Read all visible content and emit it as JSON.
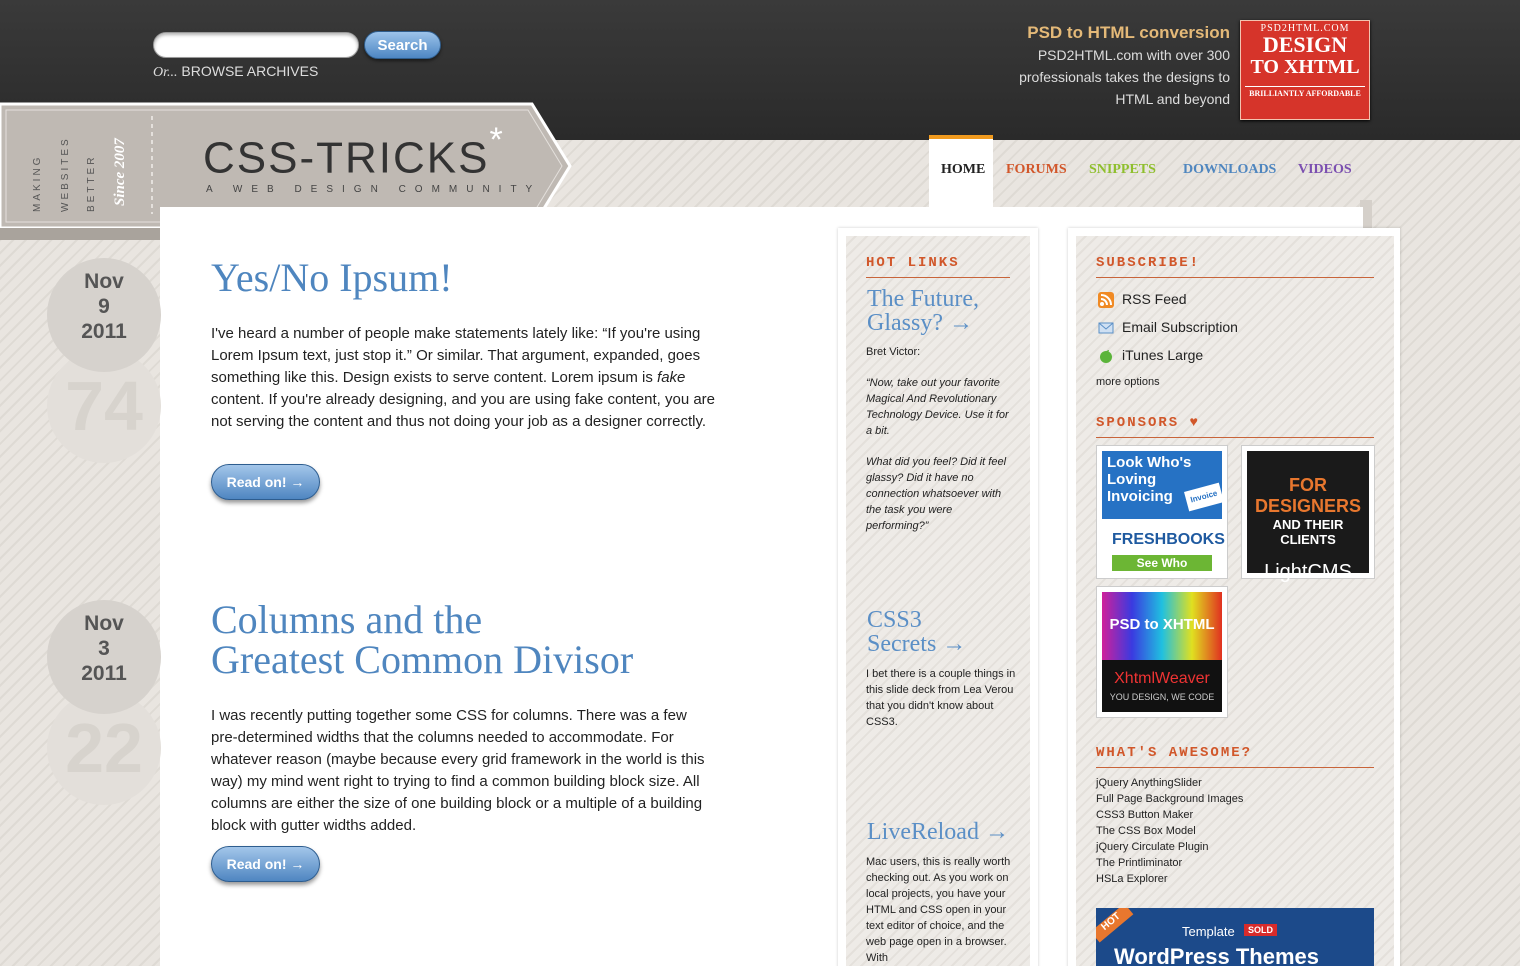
{
  "header": {
    "search_placeholder": "",
    "search_button": "Search",
    "archives_prefix": "Or...",
    "archives_label": "BROWSE ARCHIVES",
    "ad_title": "PSD to HTML conversion",
    "ad_line1": "PSD2HTML.com with over 300",
    "ad_line2": "professionals takes the designs to",
    "ad_line3": "HTML and beyond",
    "ad_banner_top": "PSD2HTML.COM",
    "ad_banner_line1": "DESIGN",
    "ad_banner_line2": "TO XHTML",
    "ad_banner_bottom": "BRILLIANTLY AFFORDABLE"
  },
  "logo": {
    "name": "CSS-TRICKS",
    "asterisk": "*",
    "tagline": "A WEB DESIGN COMMUNITY",
    "side_words": [
      "MAKING",
      "WEBSITES",
      "BETTER"
    ],
    "since": "Since 2007"
  },
  "nav": {
    "items": [
      {
        "label": "HOME",
        "color": "#222222"
      },
      {
        "label": "FORUMS",
        "color": "#d2572b"
      },
      {
        "label": "SNIPPETS",
        "color": "#8fbf2e"
      },
      {
        "label": "DOWNLOADS",
        "color": "#4f86bf"
      },
      {
        "label": "VIDEOS",
        "color": "#7b4fb0"
      }
    ]
  },
  "posts": [
    {
      "month": "Nov",
      "day": "9",
      "year": "2011",
      "comments": "74",
      "title": "Yes/No Ipsum!",
      "body_before_em": "I've heard a number of people make statements lately like: “If you're using Lorem Ipsum text, just stop it.” Or similar. That argument, expanded, goes something like this. Design exists to serve content. Lorem ipsum is ",
      "body_em": "fake",
      "body_after_em": " content. If you're already designing, and you are using fake content, you are not serving the content and thus not doing your job as a designer correctly.",
      "button": "Read on! →"
    },
    {
      "month": "Nov",
      "day": "3",
      "year": "2011",
      "comments": "22",
      "title_line1": "Columns and the",
      "title_line2": "Greatest Common Divisor",
      "body": "I was recently putting together some CSS for columns. There was a few pre-determined widths that the columns needed to accommodate. For whatever reason (maybe because every grid framework in the world is this way) my mind went right to trying to find a common building block size. All columns are either the size of one building block or a multiple of a building block with gutter widths added.",
      "button": "Read on! →"
    }
  ],
  "hot_links": {
    "heading": "HOT LINKS",
    "items": [
      {
        "title_line1": "The Future,",
        "title_line2": "Glassy? →",
        "author": "Bret Victor:",
        "quote1": "“Now, take out your favorite Magical And Revolutionary Technology Device. Use it for a bit.",
        "quote2": "What did you feel? Did it feel glassy? Did it have no connection whatsoever with the task you were performing?”"
      },
      {
        "title_line1": "CSS3",
        "title_line2": "Secrets →",
        "text": "I bet there is a couple things in this slide deck from Lea Verou that you didn't know about CSS3."
      },
      {
        "title_line1": "LiveReload →",
        "text": "Mac users, this is really worth checking out. As you work on local projects, you have your HTML and CSS open in your text editor of choice, and the web page open in a browser. With"
      }
    ]
  },
  "subscribe": {
    "heading": "SUBSCRIBE!",
    "items": [
      {
        "label": "RSS Feed",
        "icon": "rss-icon"
      },
      {
        "label": "Email Subscription",
        "icon": "email-icon"
      },
      {
        "label": "iTunes Large",
        "icon": "apple-icon"
      }
    ],
    "more": "more options"
  },
  "sponsors": {
    "heading": "SPONSORS ♥",
    "freshbooks_line1": "Look Who's",
    "freshbooks_line2": "Loving",
    "freshbooks_line3": "Invoicing",
    "freshbooks_invoice": "Invoice",
    "freshbooks_brand": "FRESHBOOKS",
    "freshbooks_cta": "See Who",
    "lightcms_line1": "FOR DESIGNERS",
    "lightcms_line2": "AND THEIR CLIENTS",
    "lightcms_brand": "LightCMS",
    "xhtml_line1": "PSD to XHTML",
    "xhtml_brand": "XhtmlWeaver",
    "xhtml_tag": "YOU DESIGN, WE CODE"
  },
  "awesome": {
    "heading": "WHAT'S AWESOME?",
    "items": [
      "jQuery AnythingSlider",
      "Full Page Background Images",
      "CSS3 Button Maker",
      "The CSS Box Model",
      "jQuery Circulate Plugin",
      "The Printliminator",
      "HSLa Explorer"
    ]
  },
  "bottom_ad": {
    "hot": "HOT",
    "template": "Template",
    "sold": "SOLD",
    "text": "WordPress Themes"
  },
  "colors": {
    "accent_blue": "#4f86bf",
    "accent_orange": "#d1572a",
    "nav_home_bar": "#f09a1e"
  }
}
